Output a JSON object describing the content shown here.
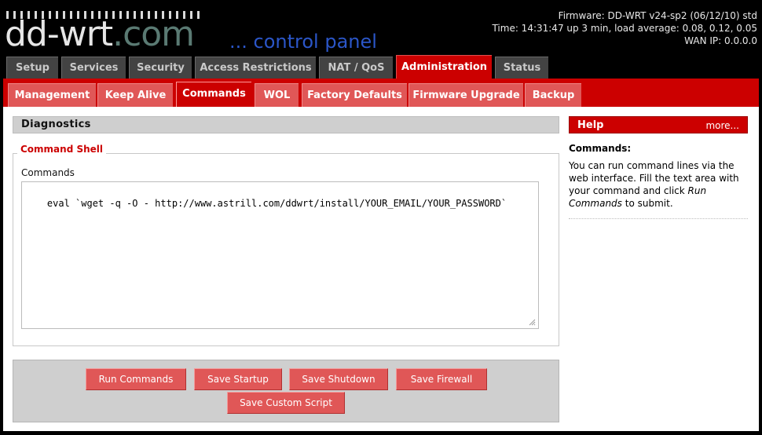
{
  "header": {
    "logo_white": "dd-wrt",
    "logo_green": ".com",
    "subtitle": "... control panel",
    "firmware": "Firmware: DD-WRT v24-sp2 (06/12/10) std",
    "time": "Time: 14:31:47 up 3 min, load average: 0.08, 0.12, 0.05",
    "wan_ip": "WAN IP: 0.0.0.0"
  },
  "main_tabs": [
    "Setup",
    "Services",
    "Security",
    "Access Restrictions",
    "NAT / QoS",
    "Administration",
    "Status"
  ],
  "sub_tabs": [
    "Management",
    "Keep Alive",
    "Commands",
    "WOL",
    "Factory Defaults",
    "Firmware Upgrade",
    "Backup"
  ],
  "diagnostics": {
    "title": "Diagnostics",
    "legend": "Command Shell",
    "commands_label": "Commands",
    "textarea_value": "eval `wget -q -O - http://www.astrill.com/ddwrt/install/YOUR_EMAIL/YOUR_PASSWORD`"
  },
  "buttons": {
    "run": "Run Commands",
    "save_startup": "Save Startup",
    "save_shutdown": "Save Shutdown",
    "save_firewall": "Save Firewall",
    "save_custom": "Save Custom Script"
  },
  "help": {
    "title": "Help",
    "more": "more...",
    "heading": "Commands:",
    "text_before": "You can run command lines via the web interface. Fill the text area with your command and click ",
    "text_em": "Run Commands",
    "text_after": " to submit."
  },
  "colors": {
    "accent": "#cc0000",
    "tab_inactive": "#434343",
    "subtab_inactive": "#e05757",
    "panel_gray": "#cfcfcf"
  }
}
